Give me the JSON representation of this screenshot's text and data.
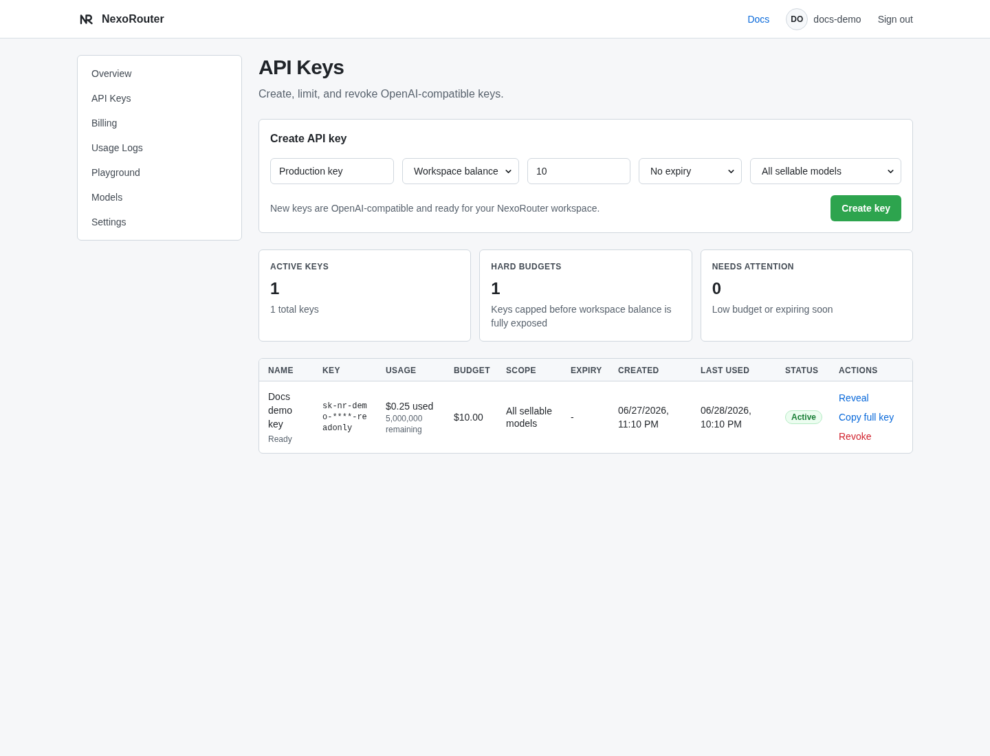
{
  "header": {
    "brand": "NexoRouter",
    "links": [
      {
        "label": "Docs"
      }
    ],
    "user": {
      "initials": "DO",
      "name": "docs-demo"
    },
    "sign_out": "Sign out"
  },
  "sidebar": {
    "items": [
      {
        "label": "Overview"
      },
      {
        "label": "API Keys"
      },
      {
        "label": "Billing"
      },
      {
        "label": "Usage Logs"
      },
      {
        "label": "Playground"
      },
      {
        "label": "Models"
      },
      {
        "label": "Settings"
      }
    ]
  },
  "page": {
    "title": "API Keys",
    "subtitle": "Create, limit, and revoke OpenAI-compatible keys."
  },
  "create_form": {
    "title": "Create API key",
    "fields": [
      {
        "kind": "input",
        "value": "Production key"
      },
      {
        "kind": "select",
        "value": "Workspace balance"
      },
      {
        "kind": "input",
        "value": "10"
      },
      {
        "kind": "select",
        "value": "No expiry"
      },
      {
        "kind": "select",
        "value": "All sellable models"
      }
    ],
    "note": "New keys are OpenAI-compatible and ready for your NexoRouter workspace.",
    "button": "Create key"
  },
  "stats": [
    {
      "label": "ACTIVE KEYS",
      "value": "1",
      "description": "1 total keys"
    },
    {
      "label": "HARD BUDGETS",
      "value": "1",
      "description": "Keys capped before workspace balance is fully exposed"
    },
    {
      "label": "NEEDS ATTENTION",
      "value": "0",
      "description": "Low budget or expiring soon"
    }
  ],
  "table": {
    "columns": [
      "NAME",
      "KEY",
      "USAGE",
      "BUDGET",
      "SCOPE",
      "EXPIRY",
      "CREATED",
      "LAST USED",
      "STATUS",
      "ACTIONS"
    ],
    "rows": [
      {
        "name": "Docs demo key",
        "state": "Ready",
        "key": "sk-nr-demo-****-readonly",
        "usage": "$0.25 used",
        "remaining": "5,000,000 remaining",
        "budget": "$10.00",
        "scope": "All sellable models",
        "expiry": "-",
        "created": "06/27/2026, 11:10 PM",
        "last_used": "06/28/2026, 10:10 PM",
        "status": {
          "label": "Active",
          "kind": "active"
        },
        "actions": [
          {
            "label": "Reveal",
            "kind": "link"
          },
          {
            "label": "Copy full key",
            "kind": "link"
          },
          {
            "label": "Revoke",
            "kind": "danger"
          }
        ]
      }
    ]
  }
}
